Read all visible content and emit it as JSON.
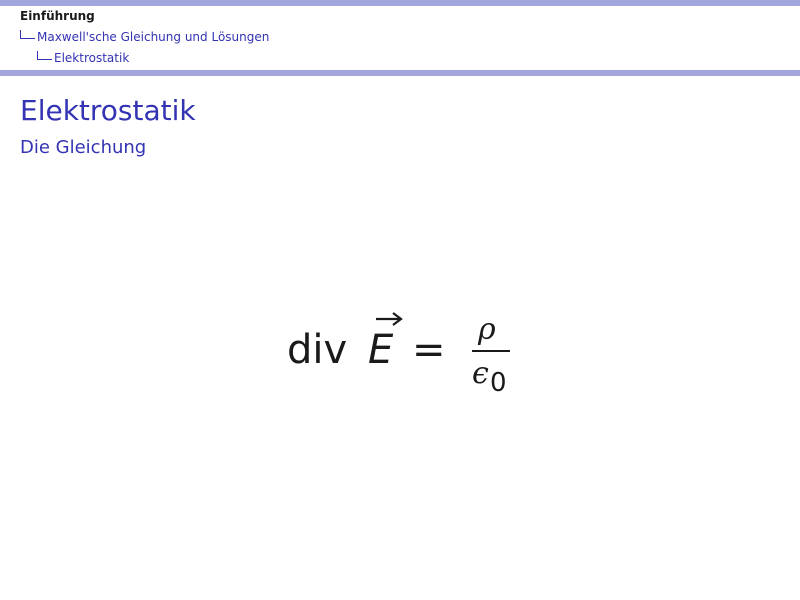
{
  "breadcrumb": {
    "section": "Einführung",
    "subsection": "Maxwell'sche Gleichung und Lösungen",
    "subsubsection": "Elektrostatik"
  },
  "frame": {
    "title": "Elektrostatik",
    "subtitle": "Die Gleichung"
  },
  "equation": {
    "operator": "div",
    "field": "E",
    "equals": "=",
    "numerator": "ρ",
    "denominator_symbol": "ϵ",
    "denominator_subscript": "0"
  },
  "colors": {
    "accent": "#3333b3",
    "bar": "#a3a6dc",
    "text": "#1a1a1a"
  }
}
